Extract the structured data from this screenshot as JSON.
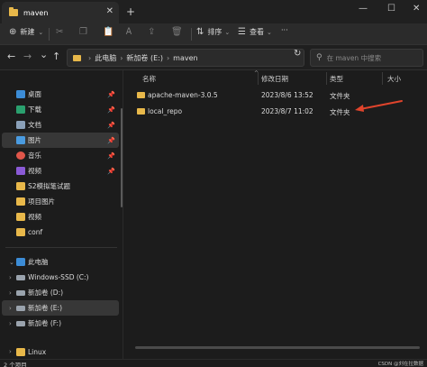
{
  "tab": {
    "title": "maven"
  },
  "window": {
    "new_tab": "+",
    "minimize": "—",
    "maximize": "☐",
    "close": "✕",
    "tab_close": "✕"
  },
  "toolbar": {
    "new_label": "新建",
    "sort_label": "排序",
    "view_label": "查看",
    "more_label": "···"
  },
  "navbar": {
    "back": "←",
    "forward": "→",
    "dropdown": "⌄",
    "up": "↑",
    "breadcrumb": [
      "此电脑",
      "新加卷 (E:)",
      "maven"
    ],
    "refresh": "↻",
    "search_placeholder": "在 maven 中搜索"
  },
  "sidebar": {
    "quick_access": [
      {
        "label": "桌面",
        "icon": "desktop-icon",
        "color": "#3c8cd6",
        "pinned": true
      },
      {
        "label": "下载",
        "icon": "download-icon",
        "color": "#2aa06e",
        "pinned": true
      },
      {
        "label": "文档",
        "icon": "document-icon",
        "color": "#8aa0b8",
        "pinned": true
      },
      {
        "label": "图片",
        "icon": "pictures-icon",
        "color": "#4a9be0",
        "pinned": true
      },
      {
        "label": "音乐",
        "icon": "music-icon",
        "color": "#e0564a",
        "pinned": true
      },
      {
        "label": "视频",
        "icon": "video-icon",
        "color": "#8a5ad6",
        "pinned": true
      },
      {
        "label": "S2模拟笔试题",
        "icon": "folder-icon",
        "color": "#e8b84a",
        "pinned": false
      },
      {
        "label": "项目图片",
        "icon": "folder-icon",
        "color": "#e8b84a",
        "pinned": false
      },
      {
        "label": "视频",
        "icon": "folder-icon",
        "color": "#e8b84a",
        "pinned": false
      },
      {
        "label": "conf",
        "icon": "folder-icon",
        "color": "#e8b84a",
        "pinned": false
      }
    ],
    "this_pc": "此电脑",
    "drives": [
      {
        "label": "Windows-SSD (C:)"
      },
      {
        "label": "新加卷 (D:)"
      },
      {
        "label": "新加卷 (E:)"
      },
      {
        "label": "新加卷 (F:)"
      }
    ],
    "linux": "Linux"
  },
  "columns": {
    "name": "名称",
    "date": "修改日期",
    "type": "类型",
    "size": "大小"
  },
  "files": [
    {
      "name": "apache-maven-3.0.5",
      "date": "2023/8/6 13:52",
      "type": "文件夹",
      "size": ""
    },
    {
      "name": "local_repo",
      "date": "2023/8/7 11:02",
      "type": "文件夹",
      "size": ""
    }
  ],
  "status": {
    "count": "2 个项目",
    "watermark": "CSDN @刘在拉数据"
  },
  "colors": {
    "accent_arrow": "#e0442c",
    "folder": "#e8b84a"
  }
}
